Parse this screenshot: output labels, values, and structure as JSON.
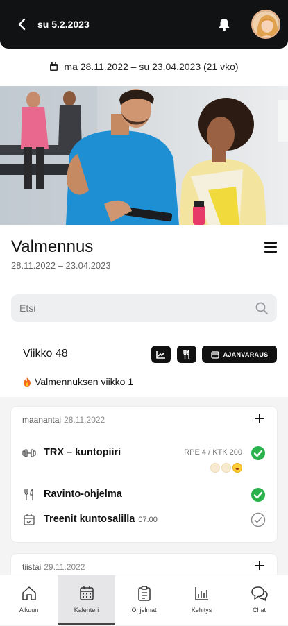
{
  "header": {
    "date": "su 5.2.2023"
  },
  "range": {
    "text": "ma 28.11.2022 – su 23.04.2023 (21 vko)"
  },
  "program": {
    "title": "Valmennus",
    "dates": "28.11.2022 – 23.04.2023"
  },
  "search": {
    "placeholder": "Etsi"
  },
  "week": {
    "label": "Viikko 48",
    "booking_label": "AJANVARAUS",
    "coaching_week": "Valmennuksen viikko 1"
  },
  "days": [
    {
      "weekday": "maanantai",
      "date": "28.11.2022",
      "items": [
        {
          "icon": "dumbbell-icon",
          "label": "TRX – kuntopiiri",
          "time": "",
          "meta": "RPE 4 / KTK 200",
          "status": "done"
        },
        {
          "icon": "cutlery-icon",
          "label": "Ravinto-ohjelma",
          "time": "",
          "meta": "",
          "status": "done"
        },
        {
          "icon": "calendar-check-icon",
          "label": "Treenit kuntosalilla",
          "time": "07:00",
          "meta": "",
          "status": "pending"
        }
      ]
    },
    {
      "weekday": "tiistai",
      "date": "29.11.2022",
      "items": []
    }
  ],
  "tabs": [
    {
      "label": "Alkuun",
      "icon": "home-icon"
    },
    {
      "label": "Kalenteri",
      "icon": "calendar-icon"
    },
    {
      "label": "Ohjelmat",
      "icon": "clipboard-icon"
    },
    {
      "label": "Kehitys",
      "icon": "bar-chart-icon"
    },
    {
      "label": "Chat",
      "icon": "chat-icon"
    }
  ],
  "colors": {
    "accent": "#2bb24c",
    "dark": "#111214"
  }
}
